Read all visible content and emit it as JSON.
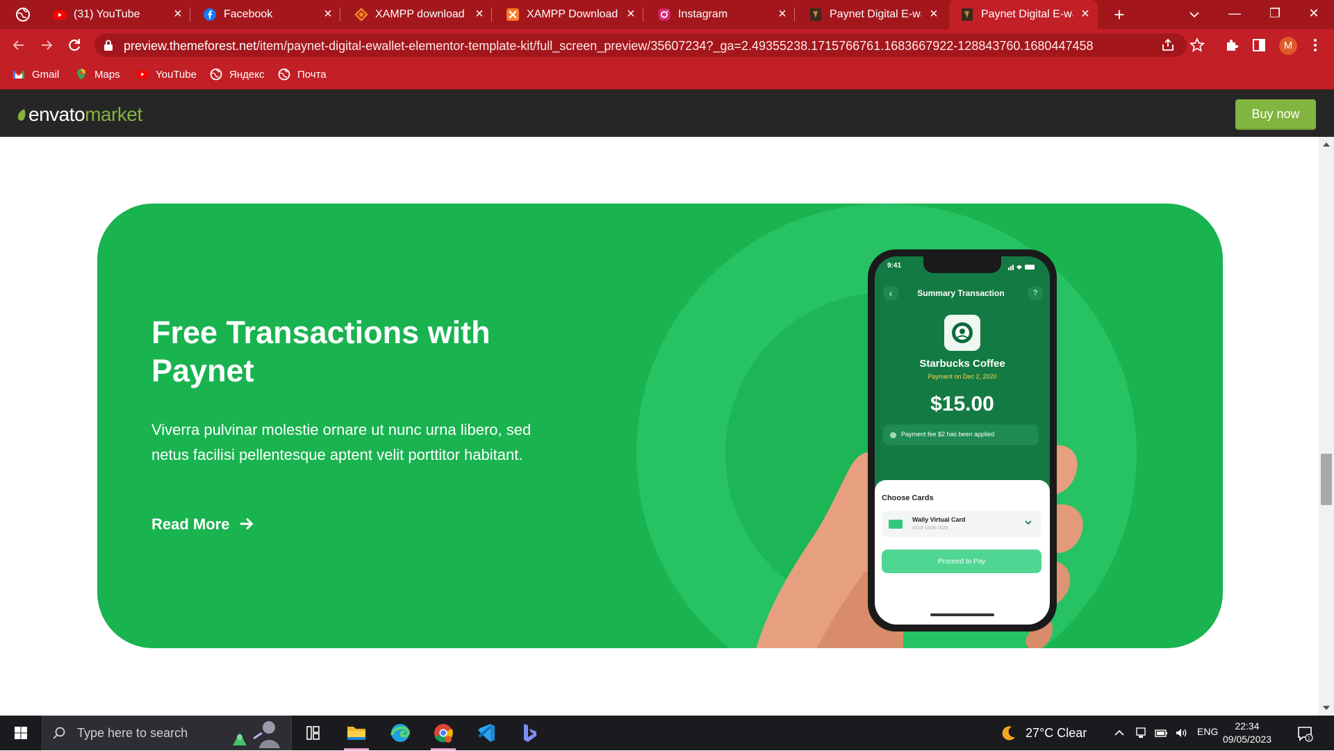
{
  "browser": {
    "tabs": [
      {
        "title": "(31) YouTube",
        "icon": "youtube-icon"
      },
      {
        "title": "Facebook",
        "icon": "facebook-icon"
      },
      {
        "title": "XAMPP download | S",
        "icon": "xampp-icon"
      },
      {
        "title": "XAMPP Download Si",
        "icon": "xampp-icon"
      },
      {
        "title": "Instagram",
        "icon": "instagram-icon"
      },
      {
        "title": "Paynet Digital E-wall",
        "icon": "paynet-icon"
      },
      {
        "title": "Paynet Digital E-wall",
        "icon": "paynet-icon",
        "active": true
      }
    ],
    "tab_close": "×",
    "new_tab": "+",
    "window_controls": {
      "minimize": "—",
      "restore": "❐",
      "close": "✕"
    },
    "url_host": "preview.themeforest.net",
    "url_path": "/item/paynet-digital-ewallet-elementor-template-kit/full_screen_preview/35607234?_ga=2.49355238.1715766761.1683667922-128843760.1680447458",
    "profile_initial": "M",
    "bookmarks": [
      {
        "label": "Gmail",
        "icon": "gmail-icon"
      },
      {
        "label": "Maps",
        "icon": "maps-icon"
      },
      {
        "label": "YouTube",
        "icon": "youtube-icon"
      },
      {
        "label": "Яндекс",
        "icon": "globe-icon"
      },
      {
        "label": "Почта",
        "icon": "globe-icon"
      }
    ],
    "accent_color": "#c21f27"
  },
  "envato": {
    "logo_word": "envato",
    "logo_market": "market",
    "buy_now": "Buy now",
    "brand_green": "#82b440"
  },
  "hero": {
    "title": "Free Transactions with Paynet",
    "description": "Viverra pulvinar molestie ornare ut nunc urna libero, sed netus facilisi pellentesque aptent  velit  porttitor habitant.",
    "read_more": "Read More",
    "background_color": "#19b350"
  },
  "phone": {
    "time": "9:41",
    "screen_title": "Summary Transaction",
    "back": "‹",
    "help": "?",
    "merchant": "Starbucks Coffee",
    "payment_date": "Payment on Dec 2, 2020",
    "amount": "$15.00",
    "fee_note": "Payment fee $2 has been applied",
    "choose_cards": "Choose Cards",
    "card_name": "Wally Virtual Card",
    "card_number": "0318-1608-2026",
    "proceed": "Proceed to Pay"
  },
  "taskbar": {
    "search_placeholder": "Type here to search",
    "weather": "27°C  Clear",
    "language": "ENG",
    "time": "22:34",
    "date": "09/05/2023",
    "notification_count": "1",
    "apps": [
      "task-view-icon",
      "file-explorer-icon",
      "edge-icon",
      "chrome-icon",
      "vscode-icon",
      "bing-icon"
    ]
  }
}
